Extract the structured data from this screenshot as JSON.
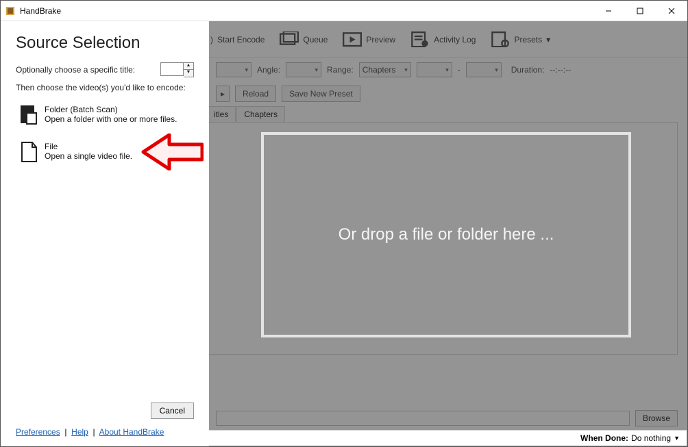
{
  "titlebar": {
    "title": "HandBrake"
  },
  "toolbar": {
    "start_encode": "Start Encode",
    "queue": "Queue",
    "preview": "Preview",
    "activity_log": "Activity Log",
    "presets": "Presets"
  },
  "source_row": {
    "angle_label": "Angle:",
    "range_label": "Range:",
    "range_mode": "Chapters",
    "dash": "-",
    "duration_label": "Duration:",
    "duration_value": "--:--:--"
  },
  "preset_row": {
    "reload": "Reload",
    "save_new": "Save New Preset"
  },
  "tabs": {
    "titles": "itles",
    "chapters": "Chapters"
  },
  "browse": "Browse",
  "status": {
    "when_done_label": "When Done:",
    "when_done_value": "Do nothing"
  },
  "panel": {
    "heading": "Source Selection",
    "opt_title_label": "Optionally choose a specific title:",
    "then_label": "Then choose the video(s) you'd like to encode:",
    "folder_title": "Folder (Batch Scan)",
    "folder_sub": "Open a folder with one or more files.",
    "file_title": "File",
    "file_sub": "Open a single video file.",
    "cancel": "Cancel",
    "links": {
      "preferences": "Preferences",
      "help": "Help",
      "about": "About HandBrake"
    }
  },
  "dropzone": {
    "text": "Or drop a file or folder here ..."
  }
}
